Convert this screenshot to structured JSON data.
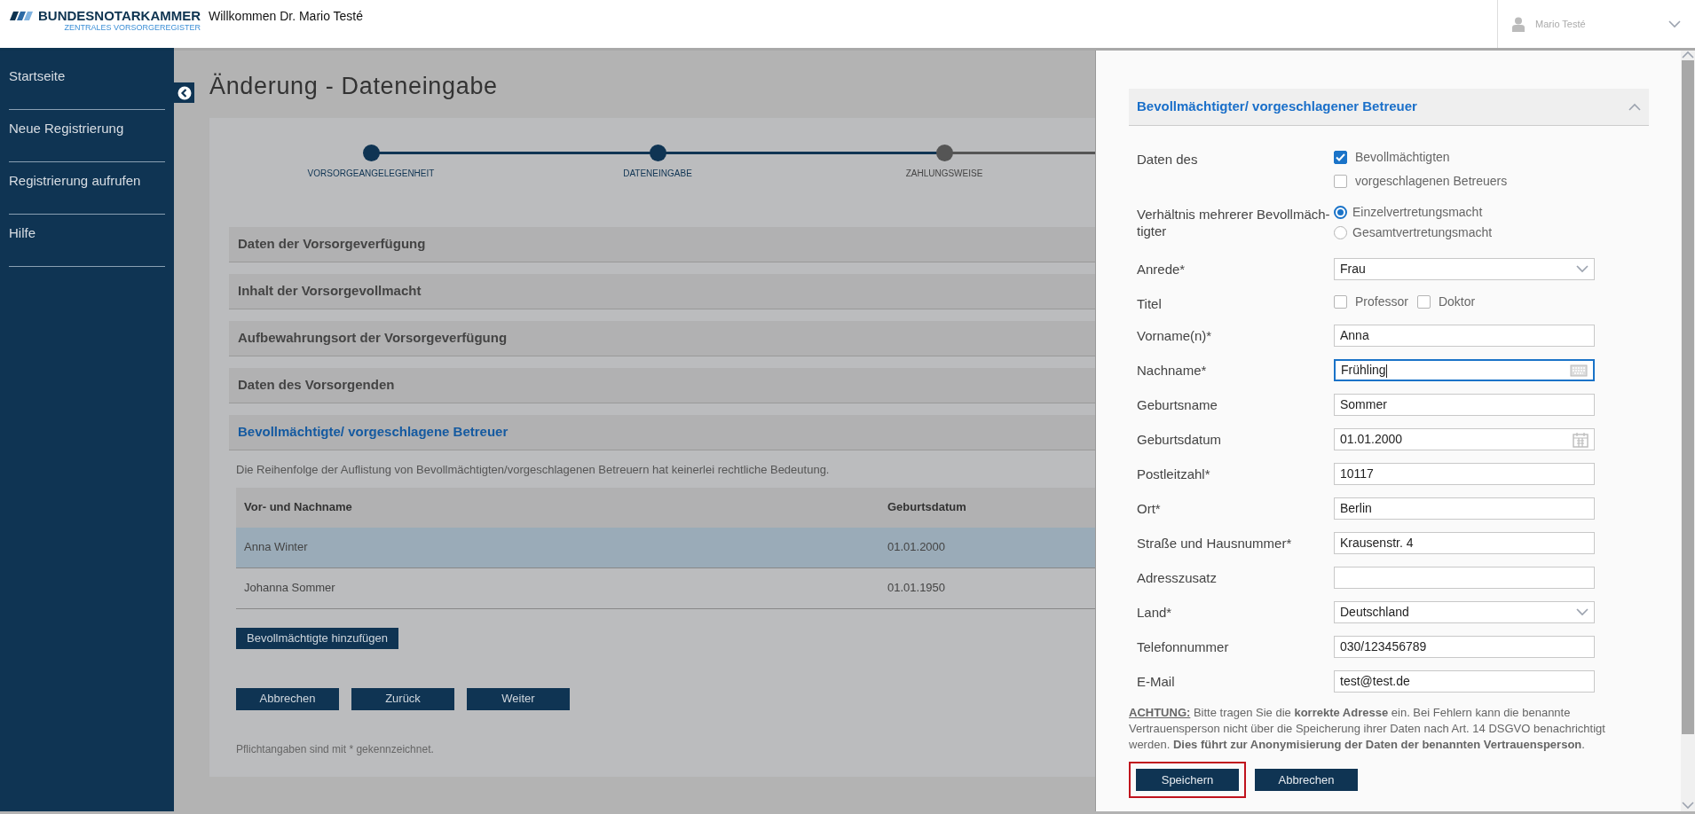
{
  "header": {
    "logo_title": "BUNDESNOTARKAMMER",
    "logo_subtitle": "ZENTRALES VORSORGEREGISTER",
    "welcome": "Willkommen Dr. Mario Testé",
    "user_name": "Mario Testé"
  },
  "sidebar": {
    "items": [
      {
        "label": "Startseite"
      },
      {
        "label": "Neue Registrierung"
      },
      {
        "label": "Registrierung aufrufen"
      },
      {
        "label": "Hilfe"
      }
    ]
  },
  "page": {
    "title": "Änderung - Dateneingabe",
    "steps": [
      {
        "label": "VORSORGEANGELEGENHEIT",
        "done": true
      },
      {
        "label": "DATENEINGABE",
        "done": true
      },
      {
        "label": "ZAHLUNGSWEISE",
        "done": false
      }
    ],
    "sections": [
      {
        "title": "Daten der Vorsorgeverfügung",
        "expanded": false
      },
      {
        "title": "Inhalt der Vorsorgevollmacht",
        "expanded": false
      },
      {
        "title": "Aufbewahrungsort der Vorsorgeverfügung",
        "expanded": false
      },
      {
        "title": "Daten des Vorsorgenden",
        "expanded": false
      },
      {
        "title": "Bevollmächtigte/ vorgeschlagene Betreuer",
        "expanded": true
      }
    ],
    "info": "Die Reihenfolge der Auflistung von Bevollmächtigten/vorgeschlagenen Betreuern hat keinerlei rechtliche Bedeutung.",
    "table": {
      "columns": [
        "Vor- und Nachname",
        "Geburtsdatum"
      ],
      "rows": [
        {
          "cells": [
            "Anna Winter",
            "01.01.2000"
          ],
          "selected": true
        },
        {
          "cells": [
            "Johanna Sommer",
            "01.01.1950"
          ],
          "selected": false
        }
      ]
    },
    "add_button": "Bevollmächtigte hinzufügen",
    "buttons": [
      "Abbrechen",
      "Zurück",
      "Weiter"
    ],
    "footnote": "Pflichtangaben sind mit * gekennzeichnet."
  },
  "panel": {
    "title": "Bevollmächtigter/ vorgeschlagener Betreuer",
    "expanded": true,
    "fields": [
      {
        "kind": "checkbox-group",
        "label": "Daten des",
        "options": [
          {
            "label": "Bevollmächtigten",
            "checked": true
          },
          {
            "label": "vorgeschlagenen Betreuers",
            "checked": false
          }
        ]
      },
      {
        "kind": "radio-group",
        "label": "Verhältnis mehrerer Bevollmäch-tigter",
        "options": [
          {
            "label": "Einzelvertretungsmacht",
            "selected": true
          },
          {
            "label": "Gesamtvertretungsmacht",
            "selected": false
          }
        ]
      },
      {
        "kind": "select",
        "label": "Anrede*",
        "value": "Frau"
      },
      {
        "kind": "checkbox-inline",
        "label": "Titel",
        "options": [
          {
            "label": "Professor",
            "checked": false
          },
          {
            "label": "Doktor",
            "checked": false
          }
        ]
      },
      {
        "kind": "input",
        "label": "Vorname(n)*",
        "value": "Anna",
        "focused": false
      },
      {
        "kind": "input",
        "label": "Nachname*",
        "value": "Frühling",
        "focused": true
      },
      {
        "kind": "input",
        "label": "Geburtsname",
        "value": "Sommer",
        "focused": false
      },
      {
        "kind": "date",
        "label": "Geburtsdatum",
        "value": "01.01.2000"
      },
      {
        "kind": "input",
        "label": "Postleitzahl*",
        "value": "10117",
        "focused": false
      },
      {
        "kind": "input",
        "label": "Ort*",
        "value": "Berlin",
        "focused": false
      },
      {
        "kind": "input",
        "label": "Straße und Hausnummer*",
        "value": "Krausenstr. 4",
        "focused": false
      },
      {
        "kind": "input",
        "label": "Adresszusatz",
        "focused": false
      },
      {
        "kind": "select",
        "label": "Land*",
        "value": "Deutschland"
      },
      {
        "kind": "input",
        "label": "Telefonnummer",
        "value": "030/123456789",
        "focused": false
      },
      {
        "kind": "input",
        "label": "E-Mail",
        "value": "test@test.de",
        "focused": false
      }
    ],
    "notice": {
      "label": "ACHTUNG:",
      "text": "Bitte tragen Sie die **korrekte Adresse** ein. Bei Fehlern kann die benannte Vertrauensperson nicht über die Speicherung ihrer Daten nach Art. 14 DSGVO benachrichtigt werden. **Dies führt zur Anonymisierung der Daten der benannten Vertrauensperson**."
    },
    "buttons": [
      {
        "label": "Speichern",
        "highlighted": true
      },
      {
        "label": "Abbrechen",
        "highlighted": false
      }
    ]
  }
}
